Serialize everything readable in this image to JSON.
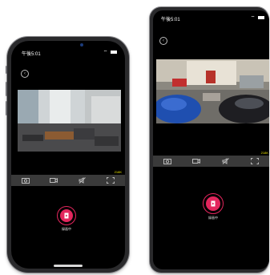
{
  "status": {
    "time": "午後5:01"
  },
  "stream": {
    "bitrate": "218K"
  },
  "toolbar": {
    "icons": [
      "camera-icon",
      "video-icon",
      "mute-icon",
      "fullscreen-icon"
    ]
  },
  "record": {
    "label": "録画中"
  },
  "colors": {
    "record_accent": "#e3265d",
    "bitrate": "#e8e000",
    "toolbar_bg": "#3a3a3a"
  }
}
